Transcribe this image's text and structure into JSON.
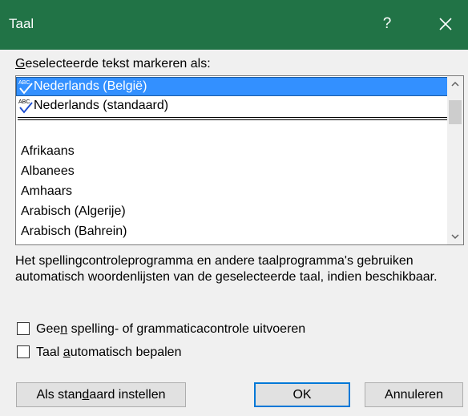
{
  "window": {
    "title": "Taal"
  },
  "titlebar": {
    "help_label": "?",
    "accent": "#217346"
  },
  "list": {
    "label_prefix": "G",
    "label_rest": "eselecteerde tekst markeren als:",
    "favorites": [
      "Nederlands (België)",
      "Nederlands (standaard)"
    ],
    "items": [
      "Afrikaans",
      "Albanees",
      "Amhaars",
      "Arabisch (Algerije)",
      "Arabisch (Bahrein)"
    ],
    "selected": "Nederlands (België)",
    "selection_color": "#3390ff"
  },
  "info_text": "Het spellingcontroleprogramma en andere taalprogramma's gebruiken automatisch woordenlijsten van de geselecteerde taal, indien beschikbaar.",
  "options": {
    "no_proofing": {
      "pre": "Gee",
      "u": "n",
      "post": " spelling- of grammaticacontrole uitvoeren",
      "checked": false
    },
    "detect_language": {
      "pre": "Taal ",
      "u": "a",
      "post": "utomatisch bepalen",
      "checked": false
    }
  },
  "buttons": {
    "set_default": {
      "pre": "Als stan",
      "u": "d",
      "post": "aard instellen"
    },
    "ok": "OK",
    "cancel": "Annuleren"
  }
}
